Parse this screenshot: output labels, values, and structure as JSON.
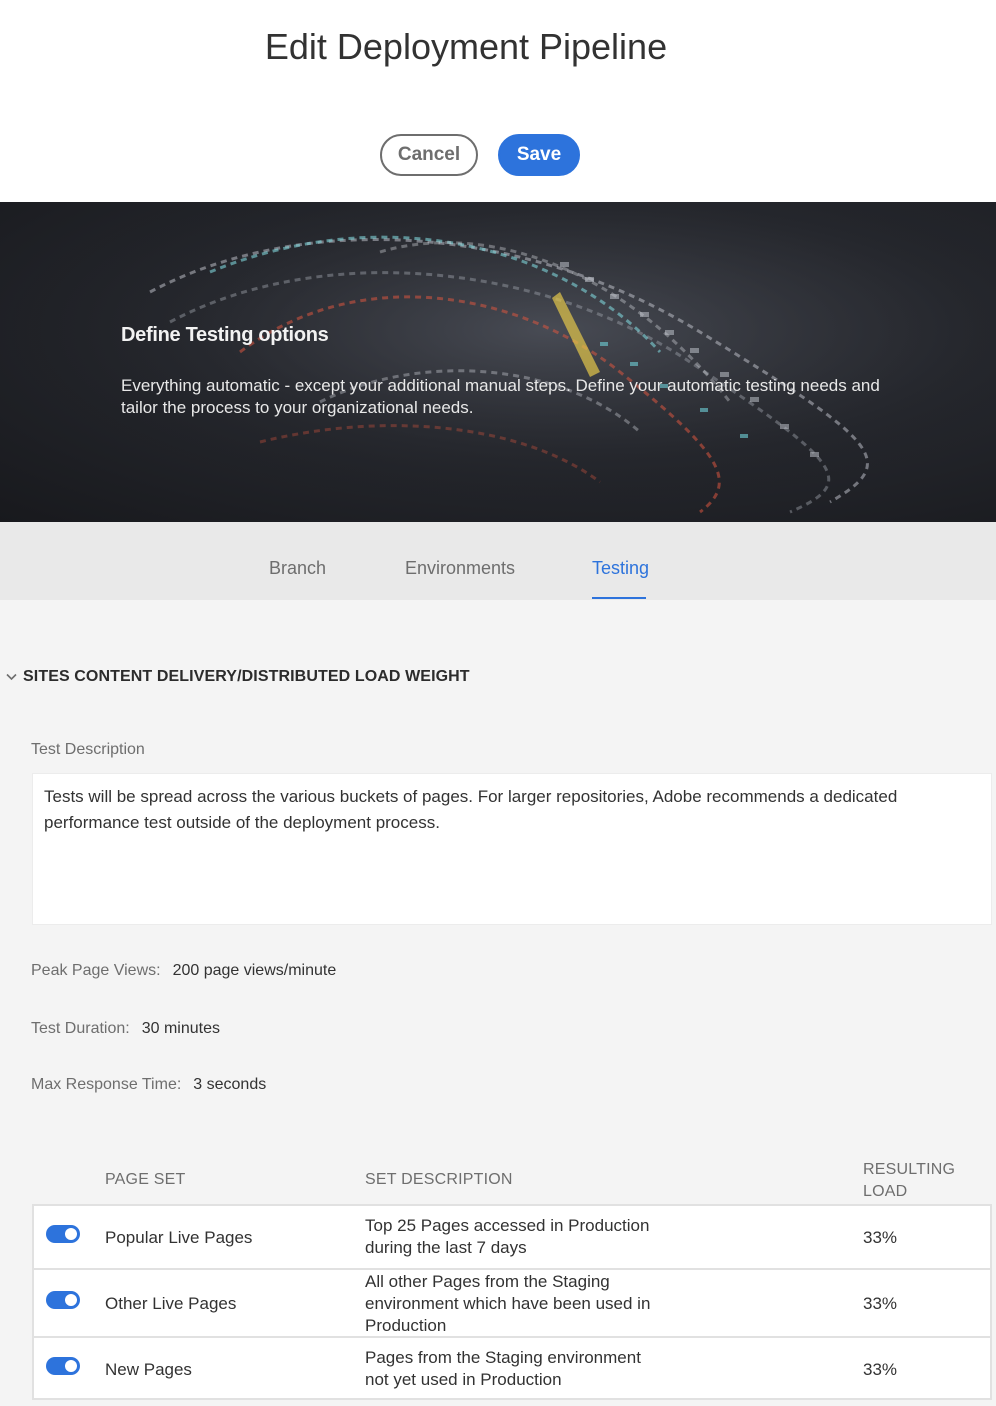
{
  "header": {
    "title": "Edit Deployment Pipeline",
    "cancel_label": "Cancel",
    "save_label": "Save"
  },
  "hero": {
    "heading": "Define Testing options",
    "text": "Everything automatic - except your additional manual steps. Define your automatic testing needs and tailor the process to your organizational needs."
  },
  "tabs": [
    {
      "label": "Branch",
      "active": false
    },
    {
      "label": "Environments",
      "active": false
    },
    {
      "label": "Testing",
      "active": true
    }
  ],
  "section": {
    "title": "SITES CONTENT DELIVERY/DISTRIBUTED LOAD WEIGHT",
    "description_label": "Test Description",
    "description": "Tests will be spread across the various buckets of pages. For larger repositories, Adobe recommends a dedicated performance test outside of the deployment process.",
    "peak_label": "Peak Page Views:",
    "peak_value": "200 page views/minute",
    "duration_label": "Test Duration:",
    "duration_value": "30 minutes",
    "response_label": "Max Response Time:",
    "response_value": "3 seconds"
  },
  "table": {
    "columns": [
      "PAGE SET",
      "SET DESCRIPTION",
      "RESULTING LOAD"
    ],
    "rows": [
      {
        "enabled": true,
        "page_set": "Popular Live Pages",
        "description": "Top 25 Pages accessed in Production during the last 7 days",
        "load": "33%"
      },
      {
        "enabled": true,
        "page_set": "Other Live Pages",
        "description": "All other Pages from the Staging environment which have been used in Production",
        "load": "33%"
      },
      {
        "enabled": true,
        "page_set": "New Pages",
        "description": "Pages from the Staging environment not yet used in Production",
        "load": "33%"
      }
    ]
  },
  "colors": {
    "accent": "#2d73dc",
    "hero_bg": "#1e2024",
    "tabbar_bg": "#e9e9e9",
    "page_bg": "#f4f4f4"
  }
}
